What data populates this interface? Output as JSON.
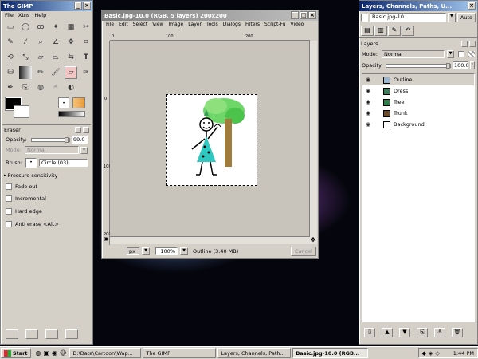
{
  "toolbox": {
    "title": "The GIMP",
    "menu": [
      "File",
      "Xtns",
      "Help"
    ],
    "brush_tile_label": "",
    "eraser": {
      "title": "Eraser",
      "opacity_label": "Opacity:",
      "opacity_value": "99.0",
      "mode_label": "Mode:",
      "mode_value": "Normal",
      "brush_label": "Brush:",
      "brush_value": "Circle (03)",
      "pressure_label": "Pressure sensitivity",
      "options": [
        "Fade out",
        "Incremental",
        "Hard edge",
        "Anti erase  <Alt>"
      ]
    }
  },
  "image_window": {
    "title": "Basic.jpg-10.0 (RGB, 5 layers) 200x200",
    "menu": [
      "File",
      "Edit",
      "Select",
      "View",
      "Image",
      "Layer",
      "Tools",
      "Dialogs",
      "Filters",
      "Script-Fu",
      "Video"
    ],
    "unit": "px",
    "zoom": "100%",
    "status": "Outline (3.40 MB)",
    "cancel_label": "Cancel",
    "ruler_marks": [
      "0",
      "100",
      "200",
      "300",
      "400"
    ]
  },
  "layers_window": {
    "title": "Layers, Channels, Paths, U...",
    "image_select": "Basic.jpg-10",
    "auto_label": "Auto",
    "section_title": "Layers",
    "mode_label": "Mode:",
    "mode_value": "Normal",
    "opacity_label": "Opacity:",
    "opacity_value": "100.0",
    "layers": [
      {
        "name": "Outline",
        "thumb": "#9bb7d0"
      },
      {
        "name": "Dress",
        "thumb": "#3f7a5b"
      },
      {
        "name": "Tree",
        "thumb": "#2e7d4a"
      },
      {
        "name": "Trunk",
        "thumb": "#6b4a2a"
      },
      {
        "name": "Background",
        "thumb": "#ffffff"
      }
    ]
  },
  "taskbar": {
    "start": "Start",
    "items": [
      "D:\\Data\\Cartoon\\Wap...",
      "The GIMP",
      "Layers, Channels, Path...",
      "Basic.jpg-10.0 (RGB..."
    ],
    "clock": "1:44 PM"
  }
}
